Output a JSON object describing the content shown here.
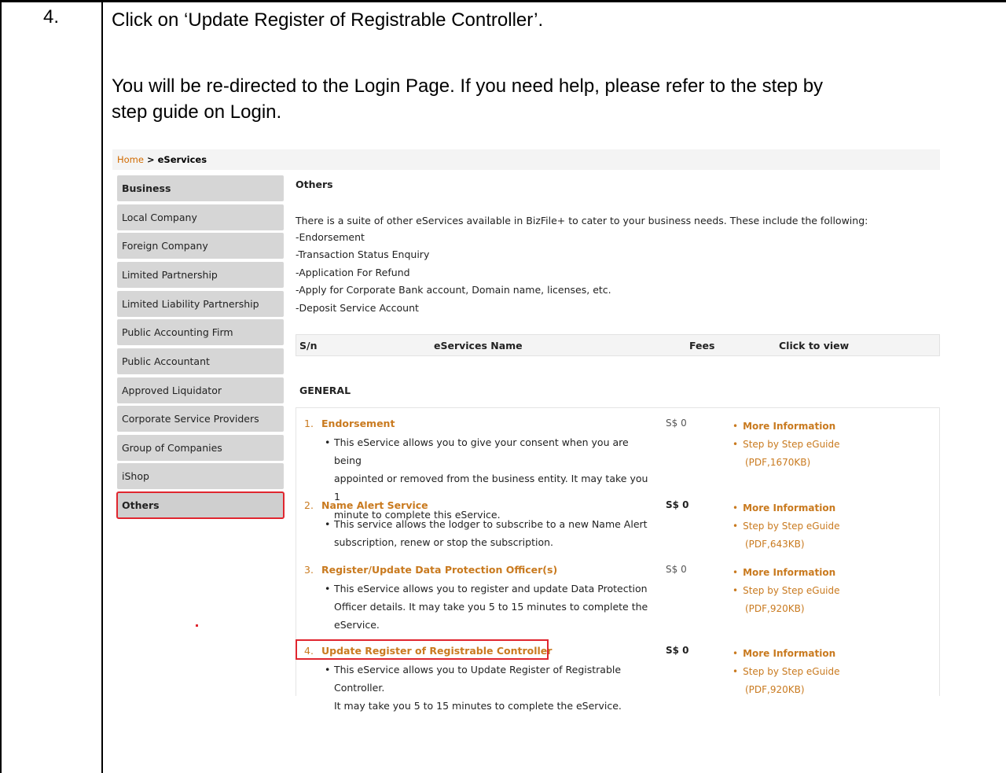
{
  "step": {
    "number": "4.",
    "instruction_line1": "Click on ‘Update Register of Registrable Controller’.",
    "instruction_line2": "You will be re-directed to the Login Page. If you need help, please refer to the step by",
    "instruction_line3": "step guide on Login."
  },
  "breadcrumb": {
    "home": "Home",
    "separator": " > ",
    "current": "eServices"
  },
  "sidebar": {
    "items": [
      {
        "label": "Business"
      },
      {
        "label": "Local Company"
      },
      {
        "label": "Foreign Company"
      },
      {
        "label": "Limited Partnership"
      },
      {
        "label": "Limited Liability Partnership"
      },
      {
        "label": "Public Accounting Firm"
      },
      {
        "label": "Public Accountant"
      },
      {
        "label": "Approved Liquidator"
      },
      {
        "label": "Corporate Service Providers"
      },
      {
        "label": "Group of Companies"
      },
      {
        "label": "iShop"
      },
      {
        "label": "Others"
      }
    ]
  },
  "main": {
    "title": "Others",
    "intro": "There is a suite of other eServices available in BizFile+ to cater to your business needs. These include the following:",
    "bullets": [
      "-Endorsement",
      "-Transaction Status Enquiry",
      "-Application For Refund",
      "-Apply for Corporate Bank account, Domain name, licenses, etc.",
      "-Deposit Service Account"
    ],
    "table_headers": {
      "sn": "S/n",
      "name": "eServices Name",
      "fees": "Fees",
      "view": "Click to view"
    },
    "group_label": "GENERAL",
    "services": [
      {
        "num": "1.",
        "name": "Endorsement",
        "fee": "S$ 0",
        "desc": [
          "This eService allows you to give your consent when you are being",
          "appointed or removed from the business entity. It may take you 1",
          "minute to complete this eService."
        ],
        "more": "More Information",
        "guide": "Step by Step eGuide",
        "meta": "(PDF,1670KB)"
      },
      {
        "num": "2.",
        "name": "Name Alert Service",
        "fee": "S$ 0",
        "desc": [
          "This service allows the lodger to subscribe to a new Name Alert",
          "subscription, renew or stop the subscription."
        ],
        "more": "More Information",
        "guide": "Step by Step eGuide",
        "meta": "(PDF,643KB)"
      },
      {
        "num": "3.",
        "name": "Register/Update Data Protection Officer(s)",
        "fee": "S$ 0",
        "desc": [
          "This eService allows you to register and update Data Protection",
          "Officer details. It may take you 5 to 15 minutes to complete the",
          "eService."
        ],
        "more": "More Information",
        "guide": "Step by Step eGuide",
        "meta": "(PDF,920KB)"
      },
      {
        "num": "4.",
        "name": "Update Register of Registrable Controller",
        "fee": "S$ 0",
        "desc": [
          "This eService allows you to Update Register of Registrable Controller.",
          "It may take you 5 to 15 minutes to complete the eService."
        ],
        "more": "More Information",
        "guide": "Step by Step eGuide",
        "meta": "(PDF,920KB)"
      }
    ]
  },
  "colors": {
    "accent": "#c97a1f",
    "highlight": "#e0262f",
    "sidebar_bg": "#d6d6d6"
  }
}
